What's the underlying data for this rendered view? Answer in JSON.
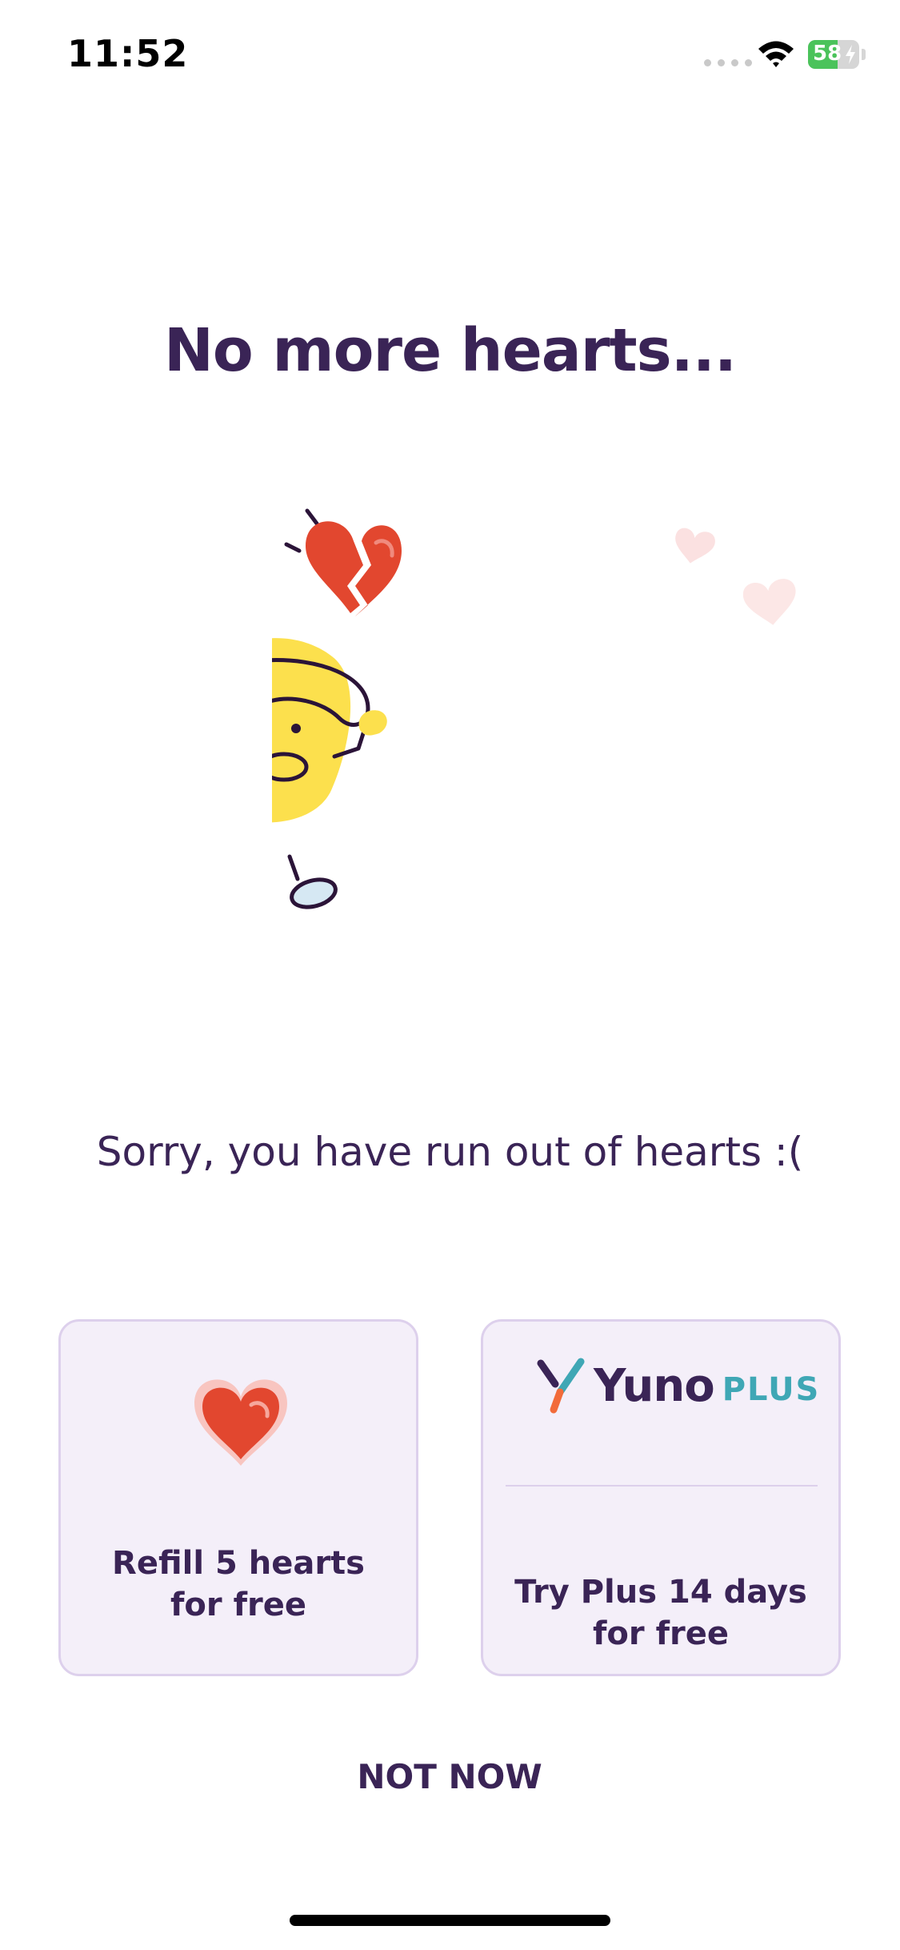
{
  "status_bar": {
    "time": "11:52",
    "battery_percent": "58",
    "battery_level": 0.58,
    "battery_color": "#4bc35b",
    "wifi_icon": "wifi-icon",
    "signal_icon": "cellular-signal-icon"
  },
  "main": {
    "title": "No more hearts...",
    "illustration_icon": "sad-mascot-broken-heart-illustration",
    "message": "Sorry, you have run out of hearts :("
  },
  "options": {
    "refill": {
      "icon": "heart-icon",
      "label_line1": "Refill 5 hearts",
      "label_line2": "for free"
    },
    "plus": {
      "logo_name": "Yuno",
      "logo_tier": "PLUS",
      "label_line1": "Try Plus 14 days",
      "label_line2": "for free"
    }
  },
  "actions": {
    "not_now": "NOT NOW"
  },
  "colors": {
    "primary_text": "#3a2456",
    "card_background": "#f4eff9",
    "card_border": "#ddd0ec",
    "heart": "#e2472f",
    "mascot": "#fce04d",
    "plus_accent": "#3fa7b5"
  }
}
